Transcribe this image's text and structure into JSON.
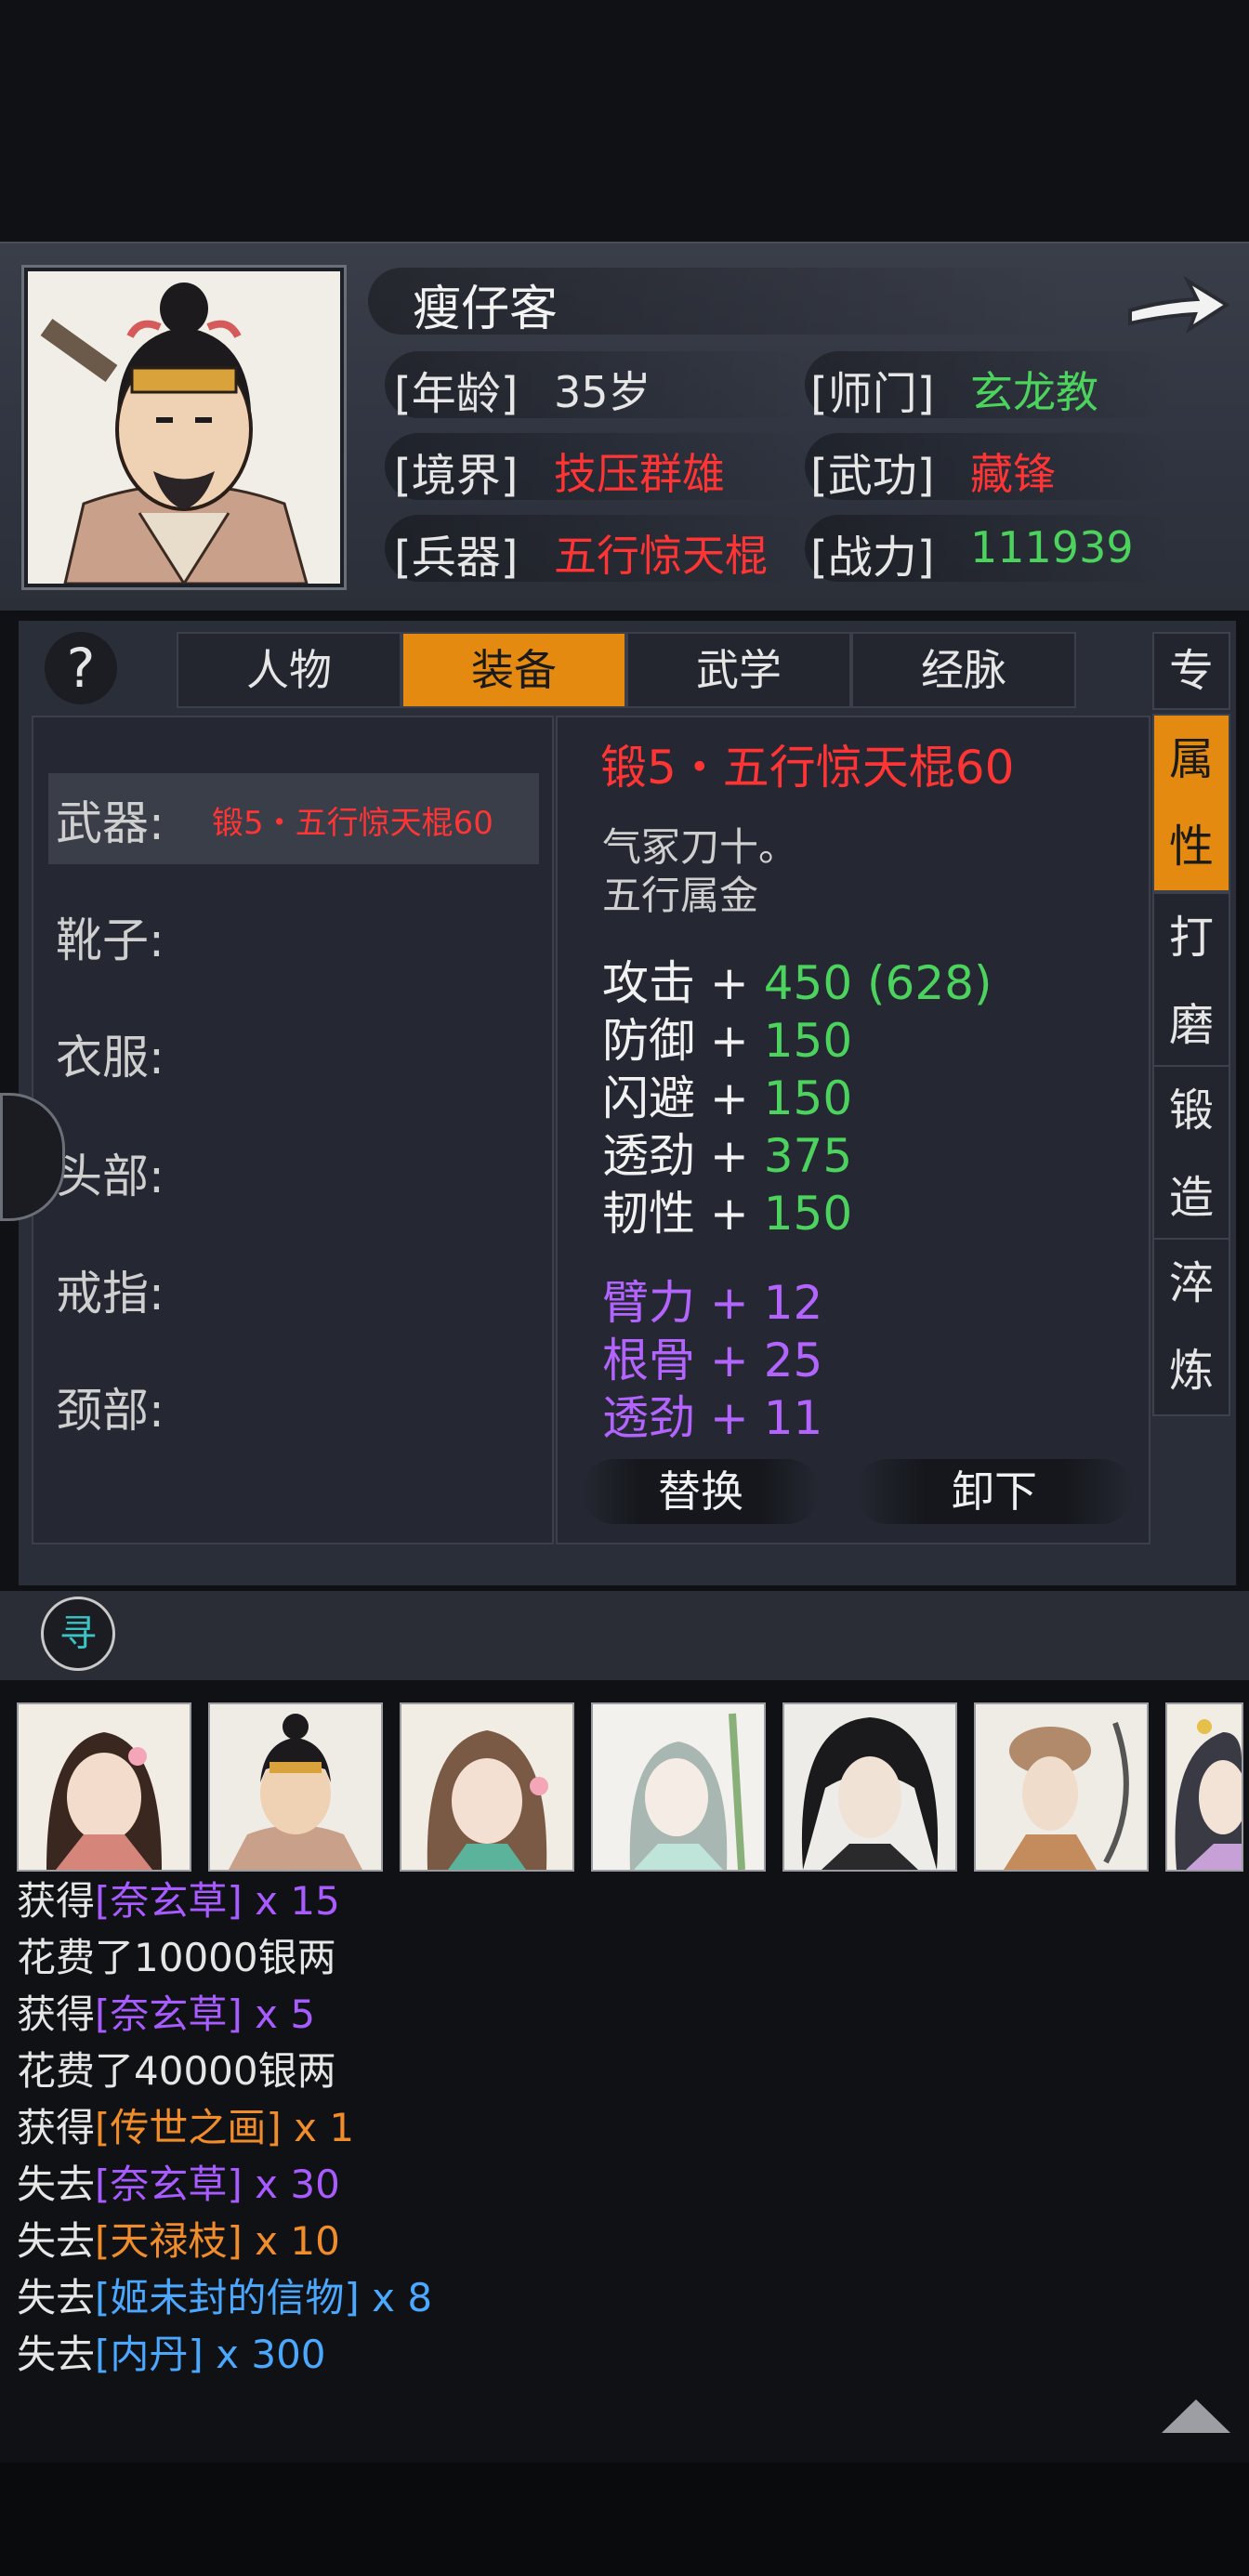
{
  "character": {
    "name": "瘦仔客",
    "age_label": "[年龄]",
    "age_value": "35岁",
    "sect_label": "[师门]",
    "sect_value": "玄龙教",
    "realm_label": "[境界]",
    "realm_value": "技压群雄",
    "martial_label": "[武功]",
    "martial_value": "藏锋",
    "weapon_label": "[兵器]",
    "weapon_value": "五行惊天棍",
    "power_label": "[战力]",
    "power_value": "111939"
  },
  "tabs": [
    {
      "label": "人物",
      "active": false
    },
    {
      "label": "装备",
      "active": true
    },
    {
      "label": "武学",
      "active": false
    },
    {
      "label": "经脉",
      "active": false
    }
  ],
  "help_symbol": "?",
  "side_tabs": [
    {
      "chars": [
        "专"
      ],
      "active": false
    },
    {
      "chars": [
        "属",
        "性"
      ],
      "active": true
    },
    {
      "chars": [
        "打",
        "磨"
      ],
      "active": false
    },
    {
      "chars": [
        "锻",
        "造"
      ],
      "active": false
    },
    {
      "chars": [
        "淬",
        "炼"
      ],
      "active": false
    }
  ],
  "slots": [
    {
      "label": "武器:",
      "item": "锻5・五行惊天棍60"
    },
    {
      "label": "靴子:",
      "item": ""
    },
    {
      "label": "衣服:",
      "item": ""
    },
    {
      "label": "头部:",
      "item": ""
    },
    {
      "label": "戒指:",
      "item": ""
    },
    {
      "label": "颈部:",
      "item": ""
    }
  ],
  "item_detail": {
    "title": "锻5・五行惊天棍60",
    "desc1": "气冢刀十。",
    "desc2": "五行属金",
    "stats": [
      {
        "name": "攻击",
        "op": "+",
        "value": "450 (628)"
      },
      {
        "name": "防御",
        "op": "+",
        "value": "150"
      },
      {
        "name": "闪避",
        "op": "+",
        "value": "150"
      },
      {
        "name": "透劲",
        "op": "+",
        "value": "375"
      },
      {
        "name": "韧性",
        "op": "+",
        "value": "150"
      }
    ],
    "bonus": [
      {
        "name": "臂力",
        "op": "+",
        "value": "12"
      },
      {
        "name": "根骨",
        "op": "+",
        "value": "25"
      },
      {
        "name": "透劲",
        "op": "+",
        "value": "11"
      }
    ],
    "replace_label": "替换",
    "unequip_label": "卸下"
  },
  "search_icon_char": "寻",
  "log": [
    {
      "prefix": "获得",
      "item": "[奈玄草]",
      "suffix": " x 15",
      "color": "purple"
    },
    {
      "prefix": "花费了10000银两",
      "item": "",
      "suffix": "",
      "color": ""
    },
    {
      "prefix": "获得",
      "item": "[奈玄草]",
      "suffix": " x 5",
      "color": "purple"
    },
    {
      "prefix": "花费了40000银两",
      "item": "",
      "suffix": "",
      "color": ""
    },
    {
      "prefix": "获得",
      "item": "[传世之画]",
      "suffix": " x 1",
      "color": "orange"
    },
    {
      "prefix": "失去",
      "item": "[奈玄草]",
      "suffix": " x 30",
      "color": "purple"
    },
    {
      "prefix": "失去",
      "item": "[天禄枝]",
      "suffix": " x 10",
      "color": "orange"
    },
    {
      "prefix": "失去",
      "item": "[姬未封的信物]",
      "suffix": " x 8",
      "color": "blue"
    },
    {
      "prefix": "失去",
      "item": "[内丹]",
      "suffix": " x 300",
      "color": "blue"
    }
  ],
  "colors": {
    "accent_orange": "#e48a10",
    "red": "#ff3434",
    "green": "#4bd35d",
    "purple": "#a85bff",
    "blue": "#4aa8ff"
  }
}
